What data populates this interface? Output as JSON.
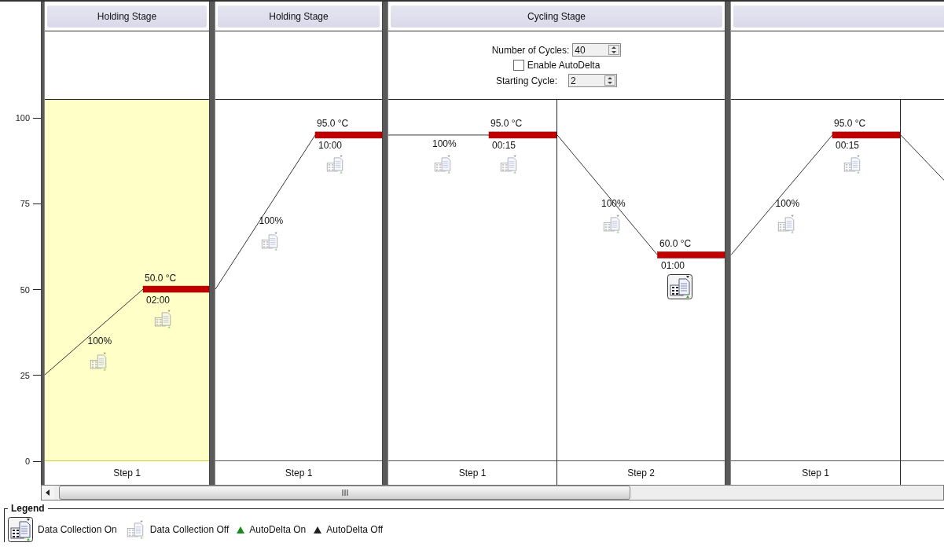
{
  "y_axis": {
    "ticks": [
      "100",
      "75",
      "50",
      "25",
      "0"
    ]
  },
  "stages": [
    {
      "title": "Holding Stage",
      "kind": "holding",
      "steps": [
        {
          "kind": "step",
          "label": "Step 1",
          "selected": true,
          "temperature": "50.0 °C",
          "time": "02:00",
          "ramp_rate": "100%",
          "ramp_collection": false,
          "hold_collection": false
        }
      ]
    },
    {
      "title": "Holding Stage",
      "kind": "holding",
      "steps": [
        {
          "kind": "step",
          "label": "Step 1",
          "selected": false,
          "temperature": "95.0 °C",
          "time": "10:00",
          "ramp_rate": "100%",
          "ramp_collection": false,
          "hold_collection": false
        }
      ]
    },
    {
      "title": "Cycling Stage",
      "kind": "cycling",
      "cycles_label": "Number of Cycles:",
      "cycles": "40",
      "autodelta_label": "Enable AutoDelta",
      "autodelta": false,
      "starting_cycle_label": "Starting Cycle:",
      "starting_cycle": "2",
      "steps": [
        {
          "kind": "step",
          "label": "Step 1",
          "selected": false,
          "temperature": "95.0 °C",
          "time": "00:15",
          "ramp_rate": "100%",
          "ramp_collection": false,
          "hold_collection": false
        },
        {
          "kind": "step",
          "label": "Step 2",
          "selected": false,
          "temperature": "60.0 °C",
          "time": "01:00",
          "ramp_rate": "100%",
          "ramp_collection": false,
          "hold_collection": true
        }
      ]
    },
    {
      "kind": "holding",
      "steps": [
        {
          "kind": "step",
          "label": "Step 1",
          "selected": false,
          "temperature": "95.0 °C",
          "time": "00:15",
          "ramp_rate": "100%",
          "ramp_collection": false,
          "hold_collection": false
        },
        {
          "kind": "cut",
          "selected": false
        }
      ]
    }
  ],
  "legend": {
    "title": "Legend",
    "items": [
      {
        "kind": "dc_on",
        "label": "Data Collection On"
      },
      {
        "kind": "dc_off",
        "label": "Data Collection Off"
      },
      {
        "kind": "ad_on",
        "label": "AutoDelta On"
      },
      {
        "kind": "ad_off",
        "label": "AutoDelta Off"
      }
    ]
  }
}
